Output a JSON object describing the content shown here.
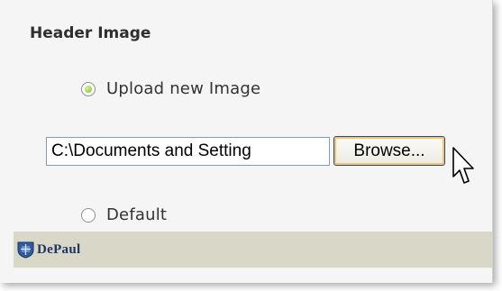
{
  "header_image": {
    "title": "Header Image",
    "upload_option": {
      "label": "Upload new Image",
      "selected": true
    },
    "file_input": {
      "value": "C:\\Documents and Setting"
    },
    "browse_button": {
      "label": "Browse..."
    },
    "default_option": {
      "label": "Default",
      "selected": false
    },
    "default_logo": {
      "text": "DePaul"
    }
  },
  "icons": {
    "cursor": "arrow-pointer-icon",
    "logo": "depaul-shield-icon"
  },
  "colors": {
    "radio_selected": "#7dbb2c",
    "logo_bar": "#d9d7c8",
    "logo_text": "#1d3563",
    "button_focus": "#f4c56a"
  }
}
